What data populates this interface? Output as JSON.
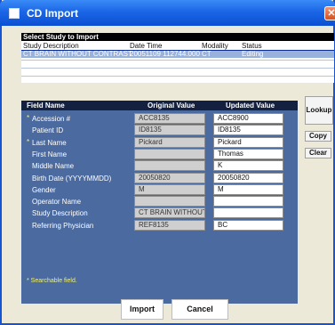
{
  "window": {
    "title": "CD Import",
    "close_glyph": "✕"
  },
  "study_list": {
    "caption": "Select Study to Import",
    "columns": [
      "Study Description",
      "Date Time",
      "Modality",
      "Status"
    ],
    "rows": [
      {
        "description": "CT BRAIN WITHOUT CONTRAST",
        "datetime": "20051109 112744.000",
        "modality": "CT",
        "status": "Editing",
        "selected": true
      }
    ]
  },
  "fields": {
    "headers": {
      "name": "Field Name",
      "original": "Original Value",
      "updated": "Updated Value"
    },
    "rows": [
      {
        "label": "Accession #",
        "searchable": true,
        "original": "ACC8135",
        "updated": "ACC8900"
      },
      {
        "label": "Patient ID",
        "searchable": false,
        "original": "ID8135",
        "updated": "ID8135"
      },
      {
        "label": "Last Name",
        "searchable": true,
        "original": "Pickard",
        "updated": "Pickard"
      },
      {
        "label": "First Name",
        "searchable": false,
        "original": "",
        "updated": "Thomas"
      },
      {
        "label": "Middle Name",
        "searchable": false,
        "original": "",
        "updated": "K"
      },
      {
        "label": "Birth Date (YYYYMMDD)",
        "searchable": false,
        "original": "20050820",
        "updated": "20050820"
      },
      {
        "label": "Gender",
        "searchable": false,
        "original": "M",
        "updated": "M"
      },
      {
        "label": "Operator Name",
        "searchable": false,
        "original": "",
        "updated": ""
      },
      {
        "label": "Study Description",
        "searchable": false,
        "original": "CT BRAIN WITHOUT CO",
        "updated": ""
      },
      {
        "label": "Referring Physician",
        "searchable": false,
        "original": "REF8135",
        "updated": "BC"
      }
    ],
    "star_glyph": "*",
    "searchable_note": "* Searchable field."
  },
  "side_buttons": {
    "lookup": "Lookup",
    "copy": "Copy",
    "clear": "Clear"
  },
  "bottom_buttons": {
    "import": "Import",
    "cancel": "Cancel"
  },
  "colors": {
    "title_bar": "#1b66e6",
    "panel": "#4b6ba0",
    "header": "#142040",
    "selection": "#99b2dc",
    "searchable": "#f2ef6a"
  }
}
